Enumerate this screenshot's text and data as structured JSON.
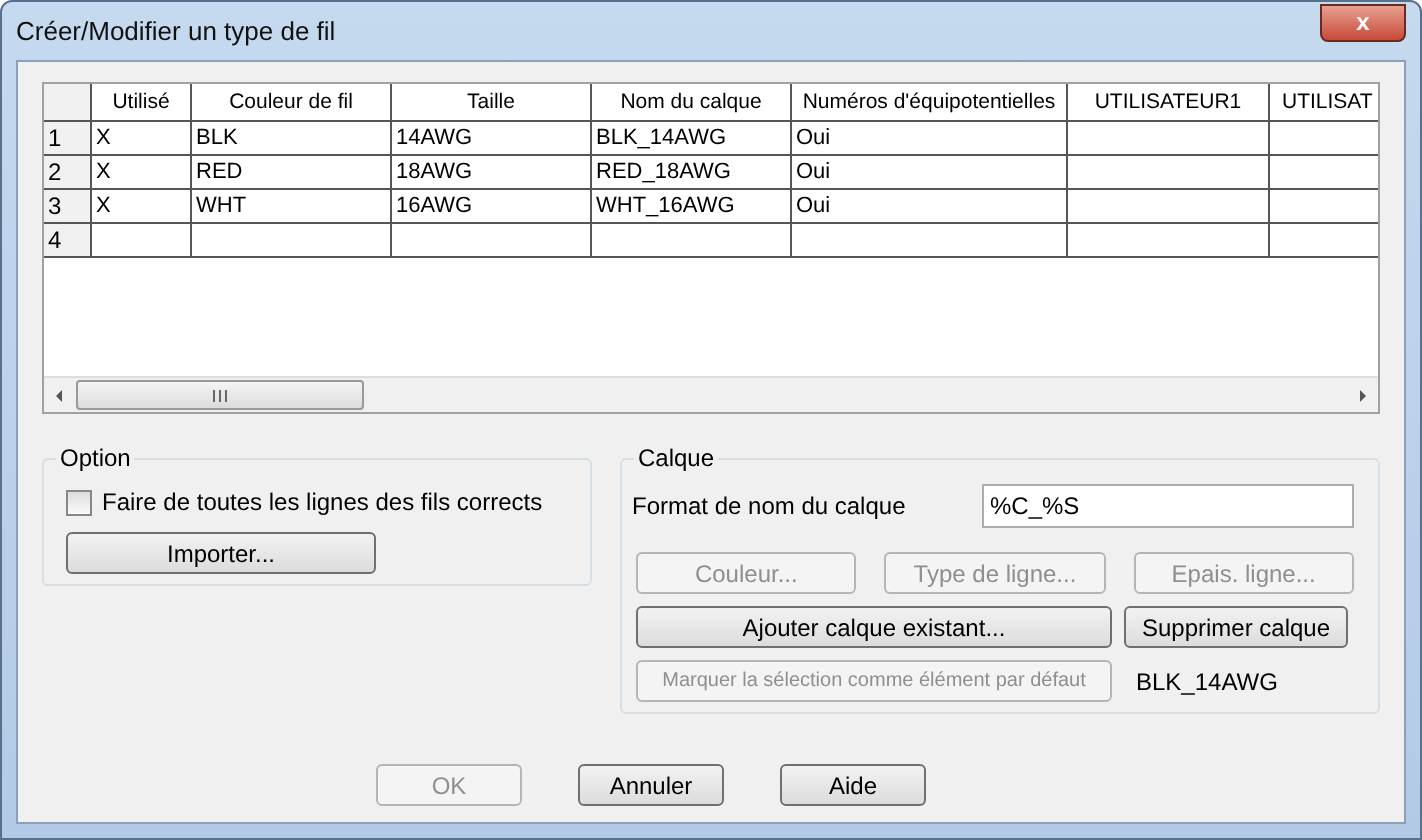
{
  "window": {
    "title": "Créer/Modifier un type de fil",
    "close": "x"
  },
  "table": {
    "columns": [
      "Utilisé",
      "Couleur de fil",
      "Taille",
      "Nom du calque",
      "Numéros d'équipotentielles",
      "UTILISATEUR1",
      "UTILISAT"
    ],
    "rows": [
      {
        "number": "1",
        "cells": [
          "X",
          "BLK",
          "14AWG",
          "BLK_14AWG",
          "Oui"
        ]
      },
      {
        "number": "2",
        "cells": [
          "X",
          "RED",
          "18AWG",
          "RED_18AWG",
          "Oui"
        ]
      },
      {
        "number": "3",
        "cells": [
          "X",
          "WHT",
          "16AWG",
          "WHT_16AWG",
          "Oui"
        ]
      },
      {
        "number": "4",
        "cells": []
      }
    ]
  },
  "option": {
    "title": "Option",
    "checkbox": {
      "label": "Faire de toutes les lignes des fils corrects",
      "checked": false
    },
    "button": {
      "label": "Importer...",
      "disabled": false
    }
  },
  "calque": {
    "title": "Calque",
    "format_label": "Format de nom du calque",
    "format_value": "%C_%S",
    "style_buttons": [
      {
        "label": "Couleur...",
        "disabled": true
      },
      {
        "label": "Type de ligne...",
        "disabled": true
      },
      {
        "label": "Epais. ligne...",
        "disabled": true
      }
    ],
    "add_button": {
      "label": "Ajouter calque existant...",
      "disabled": false
    },
    "remove_button": {
      "label": "Supprimer calque",
      "disabled": false
    },
    "default_button": {
      "label": "Marquer la sélection comme élément par défaut",
      "disabled": true
    },
    "default_value": "BLK_14AWG"
  },
  "buttons": [
    {
      "label": "OK",
      "disabled": true
    },
    {
      "label": "Annuler",
      "disabled": false
    },
    {
      "label": "Aide",
      "disabled": false
    }
  ]
}
